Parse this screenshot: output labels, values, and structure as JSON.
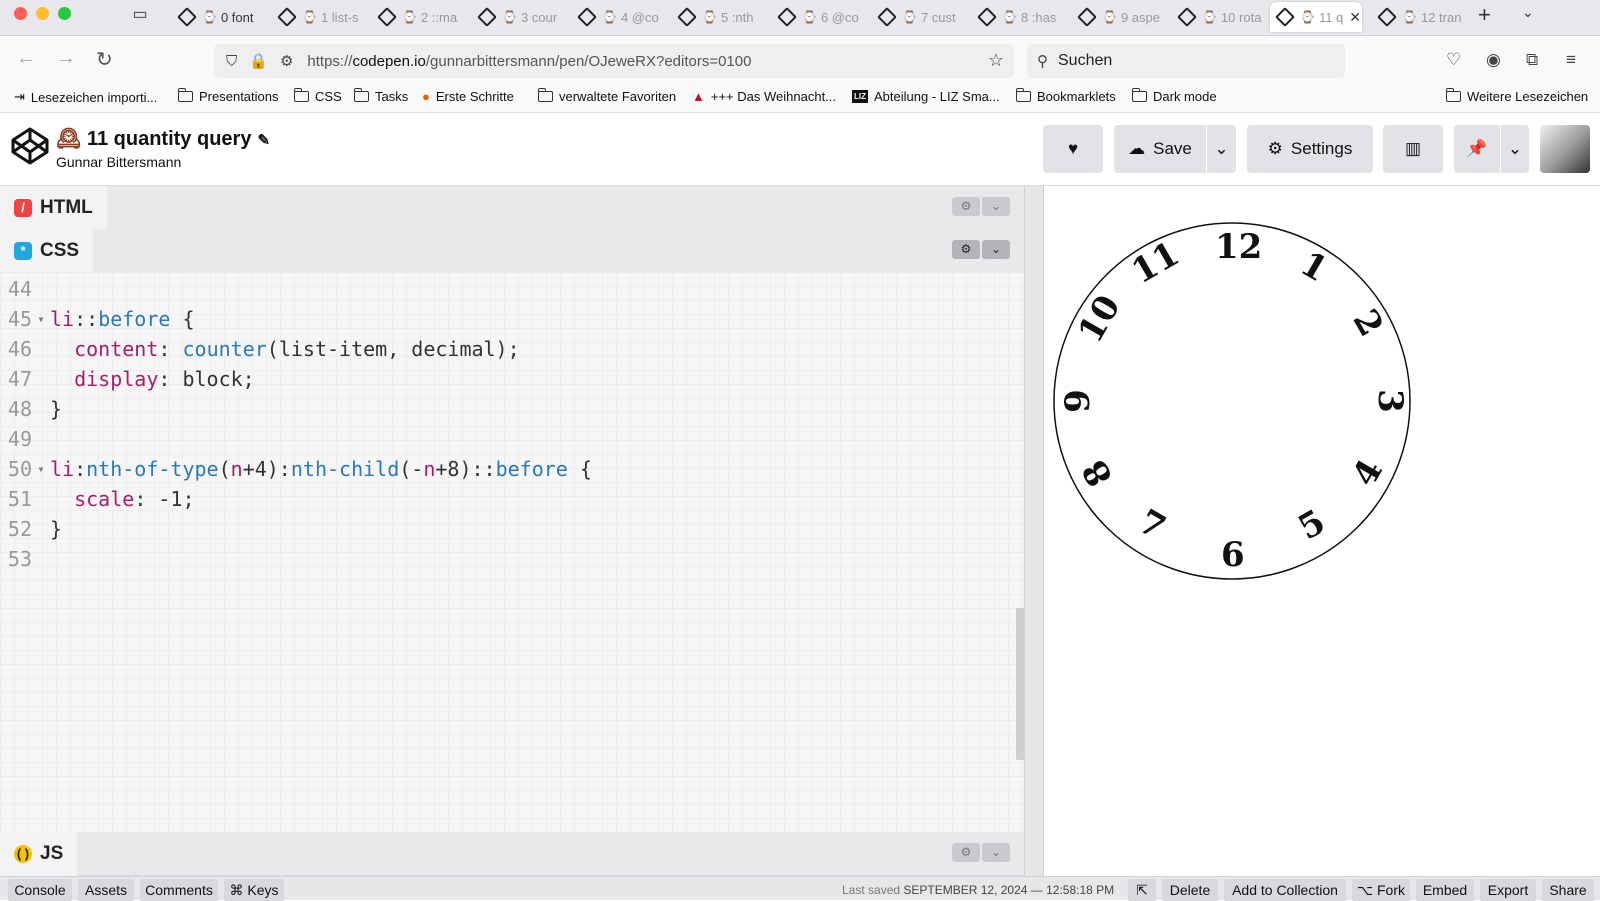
{
  "browser": {
    "tabs": [
      {
        "label": "0 font"
      },
      {
        "label": "1 list-s"
      },
      {
        "label": "2 ::ma"
      },
      {
        "label": "3 cour"
      },
      {
        "label": "4 @co"
      },
      {
        "label": "5 :nth"
      },
      {
        "label": "6 @co"
      },
      {
        "label": "7 cust"
      },
      {
        "label": "8 :has"
      },
      {
        "label": "9 aspe"
      },
      {
        "label": "10 rota"
      },
      {
        "label": "11 q"
      },
      {
        "label": "12 tran"
      }
    ],
    "url_prefix": "https://",
    "url_domain": "codepen.io",
    "url_path": "/gunnarbittersmann/pen/OJeweRX?editors=0100",
    "search_placeholder": "Suchen",
    "bookmarks": [
      "Lesezeichen importi...",
      "Presentations",
      "CSS",
      "Tasks",
      "Erste Schritte",
      "verwaltete Favoriten",
      "+++ Das Weihnacht...",
      "Abteilung - LIZ Sma...",
      "Bookmarklets",
      "Dark mode"
    ],
    "bookmarks_more": "Weitere Lesezeichen"
  },
  "pen": {
    "title_emoji": "🕰",
    "title": "11 quantity query",
    "author": "Gunnar Bittersmann",
    "save_label": "Save",
    "settings_label": "Settings"
  },
  "editors": {
    "html_label": "HTML",
    "css_label": "CSS",
    "js_label": "JS",
    "code_lines": [
      {
        "num": "44"
      },
      {
        "num": "45"
      },
      {
        "num": "46"
      },
      {
        "num": "47"
      },
      {
        "num": "48"
      },
      {
        "num": "49"
      },
      {
        "num": "50"
      },
      {
        "num": "51"
      },
      {
        "num": "52"
      },
      {
        "num": "53"
      }
    ]
  },
  "preview": {
    "clock_numbers": [
      "12",
      "1",
      "2",
      "3",
      "4",
      "5",
      "6",
      "7",
      "8",
      "9",
      "10",
      "11"
    ]
  },
  "footer": {
    "console": "Console",
    "assets": "Assets",
    "comments": "Comments",
    "keys": "⌘ Keys",
    "last_saved_label": "Last saved",
    "last_saved_value": "SEPTEMBER 12, 2024 — 12:58:18 PM",
    "delete": "Delete",
    "add_to_collection": "Add to Collection",
    "fork": "⌥ Fork",
    "embed": "Embed",
    "export": "Export",
    "share": "Share"
  }
}
